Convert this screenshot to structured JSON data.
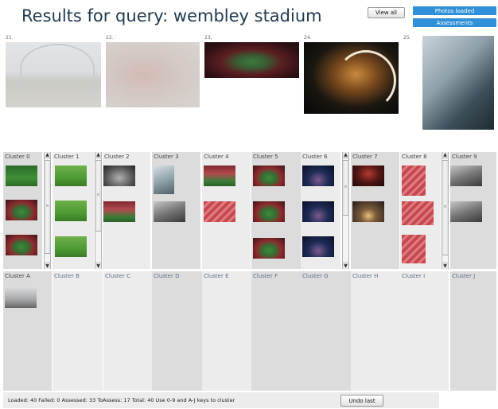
{
  "header": {
    "title": "Results for query:  wembley stadium",
    "view_all_label": "View all",
    "photos_status": "Photos loaded",
    "assessments_status": "Assessments"
  },
  "results": [
    {
      "number": "21.",
      "icon": "photo-thumbnail"
    },
    {
      "number": "22.",
      "icon": "photo-thumbnail"
    },
    {
      "number": "23.",
      "icon": "photo-thumbnail"
    },
    {
      "number": "24.",
      "icon": "photo-thumbnail"
    },
    {
      "number": "25.",
      "icon": "photo-thumbnail"
    }
  ],
  "clusters_top": [
    {
      "label": "Cluster 0"
    },
    {
      "label": "Cluster 1"
    },
    {
      "label": "Cluster 2"
    },
    {
      "label": "Cluster 3"
    },
    {
      "label": "Cluster 4"
    },
    {
      "label": "Cluster 5"
    },
    {
      "label": "Cluster 6"
    },
    {
      "label": "Cluster 7"
    },
    {
      "label": "Cluster 8"
    },
    {
      "label": "Cluster 9"
    }
  ],
  "clusters_bottom": [
    {
      "label": "Cluster A"
    },
    {
      "label": "Cluster B"
    },
    {
      "label": "Cluster C"
    },
    {
      "label": "Cluster D"
    },
    {
      "label": "Cluster E"
    },
    {
      "label": "Cluster F"
    },
    {
      "label": "Cluster G"
    },
    {
      "label": "Cluster H"
    },
    {
      "label": "Cluster I"
    },
    {
      "label": "Cluster J"
    }
  ],
  "footer": {
    "status_text": "Loaded: 40   Failed: 0   Assessed: 33   ToAssess: 17   Total: 40   Use 0-9 and A-J keys to cluster",
    "undo_label": "Undo last"
  },
  "scroll_arrows": {
    "up": "▲",
    "down": "▼",
    "grip": "≡"
  }
}
